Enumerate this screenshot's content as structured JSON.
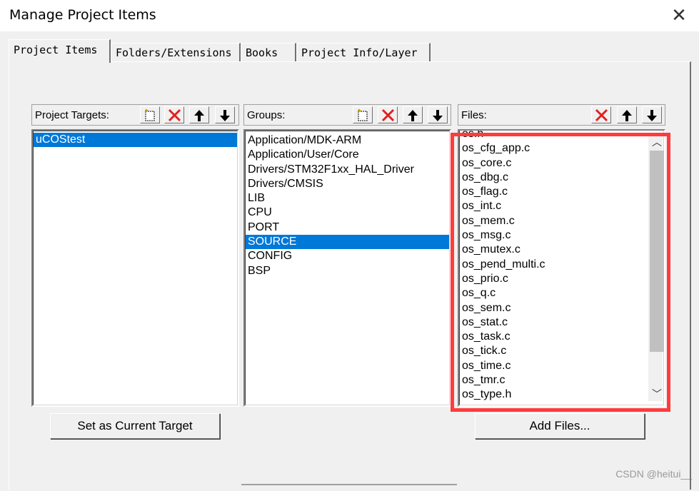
{
  "window": {
    "title": "Manage Project Items",
    "close_label": "✕"
  },
  "tabs": [
    {
      "label": "Project Items",
      "active": true
    },
    {
      "label": "Folders/Extensions",
      "active": false
    },
    {
      "label": "Books",
      "active": false
    },
    {
      "label": "Project Info/Layer",
      "active": false
    }
  ],
  "targets": {
    "label": "Project Targets:",
    "items": [
      "uCOStest"
    ],
    "selected": 0,
    "button_label": "Set as Current Target"
  },
  "groups": {
    "label": "Groups:",
    "items": [
      "Application/MDK-ARM",
      "Application/User/Core",
      "Drivers/STM32F1xx_HAL_Driver",
      "Drivers/CMSIS",
      "LIB",
      "CPU",
      "PORT",
      "SOURCE",
      "CONFIG",
      "BSP"
    ],
    "selected": 7
  },
  "files": {
    "label": "Files:",
    "items": [
      "os.h",
      "os_cfg_app.c",
      "os_core.c",
      "os_dbg.c",
      "os_flag.c",
      "os_int.c",
      "os_mem.c",
      "os_msg.c",
      "os_mutex.c",
      "os_pend_multi.c",
      "os_prio.c",
      "os_q.c",
      "os_sem.c",
      "os_stat.c",
      "os_task.c",
      "os_tick.c",
      "os_time.c",
      "os_tmr.c",
      "os_type.h"
    ],
    "button_label": "Add Files..."
  },
  "watermark": "CSDN @heitui__",
  "colors": {
    "selection": "#0078d7",
    "highlight_box": "#ff3b3b",
    "delete_icon": "#e02020"
  }
}
